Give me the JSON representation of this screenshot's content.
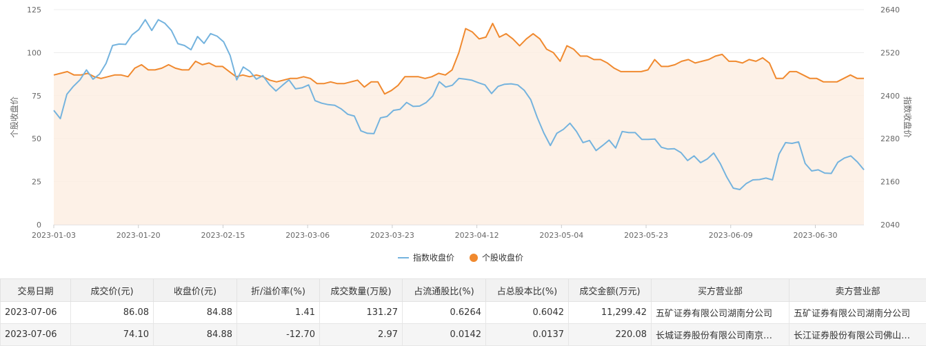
{
  "chart_data": {
    "type": "line",
    "xlabel": "",
    "ylabel_left": "个股收盘价",
    "ylabel_right": "指数收盘价",
    "ylim_left": [
      0,
      125
    ],
    "ylim_right": [
      2040,
      2640
    ],
    "yticks_left": [
      "0",
      "25",
      "50",
      "75",
      "100",
      "125"
    ],
    "yticks_right": [
      "2040",
      "2160",
      "2280",
      "2400",
      "2520",
      "2640"
    ],
    "x_tick_labels": [
      "2023-01-03",
      "2023-01-20",
      "2023-02-15",
      "2023-03-06",
      "2023-03-23",
      "2023-04-12",
      "2023-05-04",
      "2023-05-23",
      "2023-06-09",
      "2023-06-30"
    ],
    "grid": true,
    "legend_position": "bottom-center",
    "colors": {
      "index": "#74b3de",
      "stock": "#f0892e",
      "stock_area": "#fdeee3"
    },
    "series": [
      {
        "name": "指数收盘价",
        "axis": "right",
        "values": [
          2359,
          2336,
          2404,
          2426,
          2444,
          2472,
          2446,
          2460,
          2490,
          2540,
          2544,
          2543,
          2570,
          2584,
          2612,
          2582,
          2612,
          2602,
          2582,
          2545,
          2540,
          2528,
          2565,
          2546,
          2573,
          2566,
          2550,
          2512,
          2444,
          2480,
          2468,
          2446,
          2456,
          2431,
          2413,
          2429,
          2444,
          2419,
          2422,
          2430,
          2386,
          2379,
          2375,
          2373,
          2363,
          2348,
          2343,
          2302,
          2295,
          2294,
          2338,
          2342,
          2359,
          2362,
          2381,
          2370,
          2371,
          2381,
          2399,
          2439,
          2424,
          2429,
          2448,
          2446,
          2443,
          2436,
          2430,
          2406,
          2426,
          2432,
          2433,
          2430,
          2415,
          2389,
          2339,
          2296,
          2261,
          2295,
          2306,
          2323,
          2300,
          2269,
          2275,
          2247,
          2261,
          2276,
          2254,
          2300,
          2297,
          2297,
          2278,
          2278,
          2279,
          2256,
          2251,
          2252,
          2241,
          2219,
          2232,
          2213,
          2223,
          2240,
          2211,
          2173,
          2142,
          2138,
          2155,
          2165,
          2166,
          2170,
          2165,
          2237,
          2269,
          2267,
          2271,
          2211,
          2190,
          2193,
          2184,
          2183,
          2214,
          2226,
          2232,
          2215,
          2193
        ]
      },
      {
        "name": "个股收盘价",
        "axis": "left",
        "values": [
          87,
          88,
          89,
          87,
          87,
          88,
          86,
          85,
          86,
          87,
          87,
          86,
          91,
          93,
          90,
          90,
          91,
          93,
          91,
          90,
          90,
          95,
          93,
          94,
          92,
          92,
          89,
          86,
          87,
          86,
          87,
          86,
          84,
          83,
          84,
          85,
          85,
          86,
          85,
          82,
          82,
          83,
          82,
          82,
          83,
          84,
          80,
          83,
          83,
          76,
          78,
          81,
          86,
          86,
          86,
          85,
          86,
          88,
          87,
          90,
          100,
          114,
          112,
          108,
          109,
          117,
          109,
          111,
          108,
          104,
          108,
          111,
          108,
          102,
          100,
          95,
          104,
          102,
          98,
          98,
          96,
          96,
          94,
          91,
          89,
          89,
          89,
          89,
          90,
          96,
          92,
          92,
          93,
          95,
          96,
          94,
          95,
          96,
          98,
          99,
          95,
          95,
          94,
          96,
          95,
          97,
          94,
          85,
          85,
          89,
          89,
          87,
          85,
          85,
          83,
          83,
          83,
          85,
          87,
          85,
          85
        ]
      }
    ]
  },
  "table": {
    "headers": [
      "交易日期",
      "成交价(元)",
      "收盘价(元)",
      "折/溢价率(%)",
      "成交数量(万股)",
      "占流通股比(%)",
      "占总股本比(%)",
      "成交金额(万元)",
      "买方营业部",
      "卖方营业部"
    ],
    "rows": [
      [
        "2023-07-06",
        "86.08",
        "84.88",
        "1.41",
        "131.27",
        "0.6264",
        "0.6042",
        "11,299.42",
        "五矿证券有限公司湖南分公司",
        "五矿证券有限公司湖南分公司"
      ],
      [
        "2023-07-06",
        "74.10",
        "84.88",
        "-12.70",
        "2.97",
        "0.0142",
        "0.0137",
        "220.08",
        "长城证券股份有限公司南京…",
        "长江证券股份有限公司佛山…"
      ]
    ]
  }
}
